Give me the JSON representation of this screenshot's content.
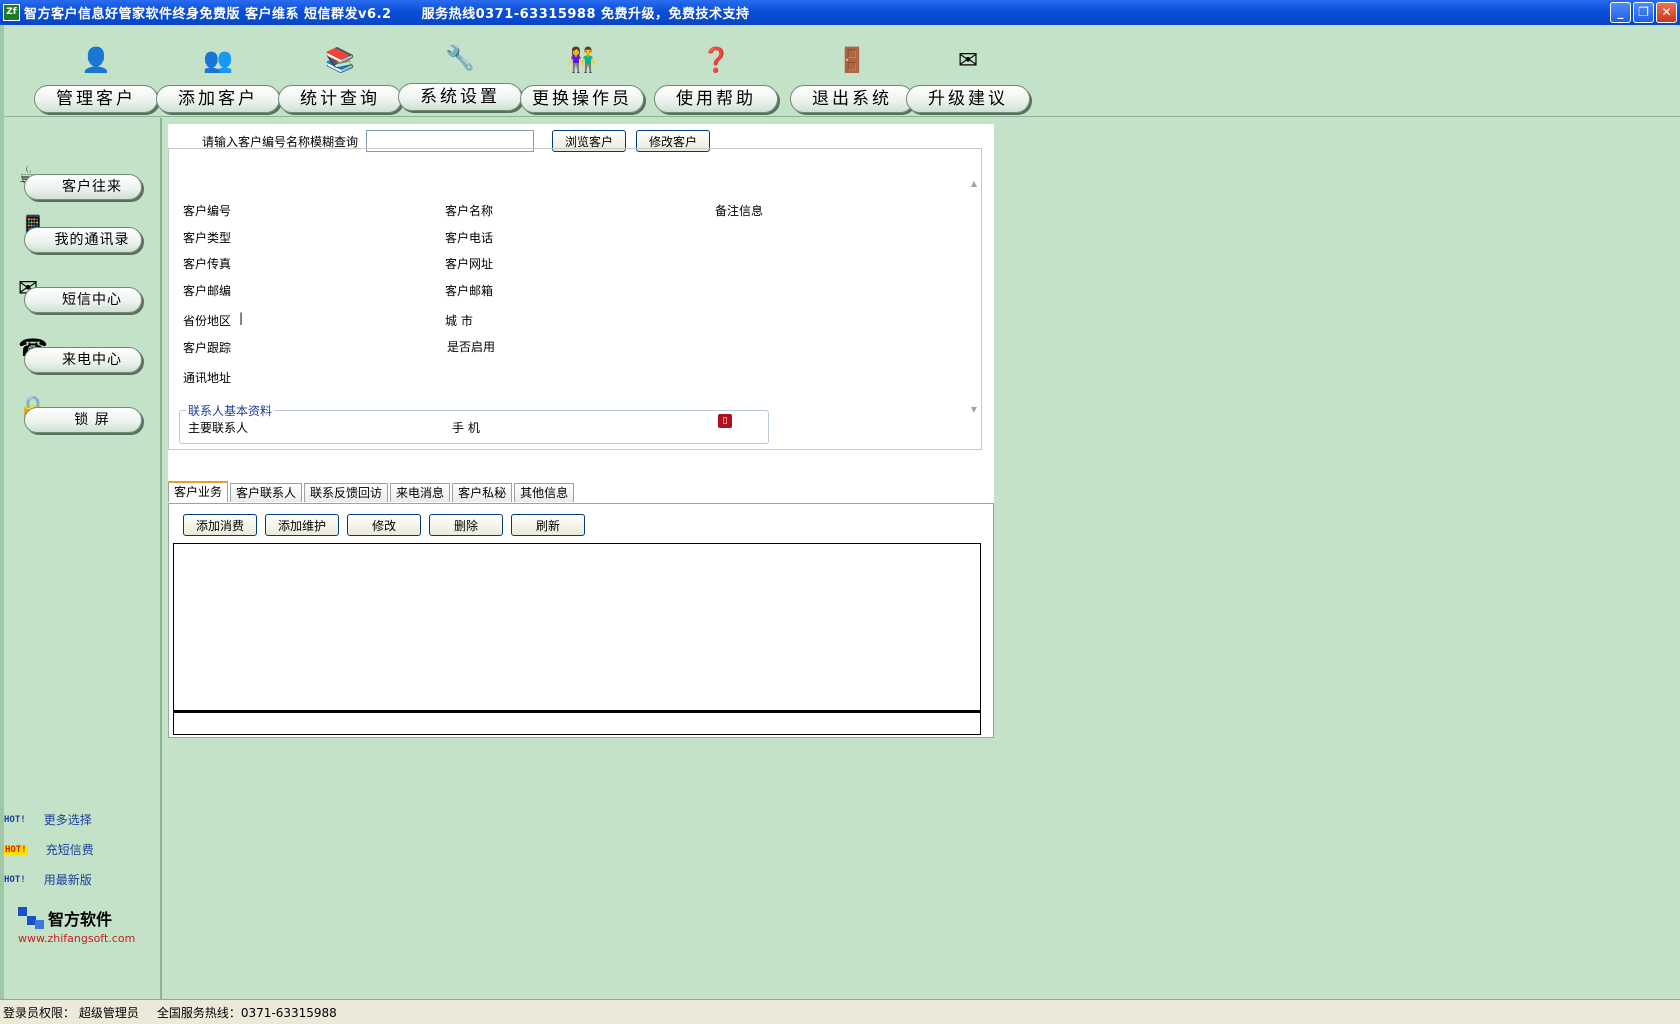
{
  "window": {
    "title": "智方客户信息好管家软件终身免费版  客户维系  短信群发v6.2",
    "hotline": "服务热线0371-63315988  免费升级，免费技术支持",
    "minimize": "_",
    "restore": "❐",
    "close": "✕"
  },
  "toolbar": [
    {
      "label": "管理客户",
      "icon": "user-icon"
    },
    {
      "label": "添加客户",
      "icon": "add-user-icon"
    },
    {
      "label": "统计查询",
      "icon": "book-search-icon"
    },
    {
      "label": "系统设置",
      "icon": "tools-icon"
    },
    {
      "label": "更换操作员",
      "icon": "users-icon"
    },
    {
      "label": "使用帮助",
      "icon": "help-icon"
    },
    {
      "label": "退出系统",
      "icon": "exit-icon"
    },
    {
      "label": "升级建议",
      "icon": "mail-icon"
    }
  ],
  "sidebar": [
    {
      "label": "客户往来",
      "icon": "exchange-icon"
    },
    {
      "label": "我的通讯录",
      "icon": "phone-book-icon"
    },
    {
      "label": "短信中心",
      "icon": "sms-icon"
    },
    {
      "label": "来电中心",
      "icon": "telephone-icon"
    },
    {
      "label": "锁    屏",
      "icon": "lock-icon"
    }
  ],
  "hot_links": [
    {
      "badge": "HOT!",
      "text": "更多选择"
    },
    {
      "badge": "HOT!",
      "text": "充短信费"
    },
    {
      "badge": "HOT!",
      "text": "用最新版"
    }
  ],
  "logo": {
    "name": "智方软件",
    "url": "www.zhifangsoft.com"
  },
  "search": {
    "label": "请输入客户编号名称模糊查询",
    "value": "",
    "browse_button": "浏览客户",
    "edit_button": "修改客户"
  },
  "fields": {
    "customer_id": "客户编号",
    "customer_name": "客户名称",
    "remarks": "备注信息",
    "customer_type": "客户类型",
    "customer_phone": "客户电话",
    "customer_fax": "客户传真",
    "customer_website": "客户网址",
    "customer_postcode": "客户邮编",
    "customer_email": "客户邮箱",
    "province": "省份地区",
    "province_value": "|",
    "city": "城    市",
    "follow_up": "客户跟踪",
    "enabled": "是否启用",
    "address": "通讯地址"
  },
  "contact": {
    "group_title": "联系人基本资料",
    "primary": "主要联系人",
    "mobile": "手    机"
  },
  "tabs": [
    "客户业务",
    "客户联系人",
    "联系反馈回访",
    "来电消息",
    "客户私秘",
    "其他信息"
  ],
  "actions": [
    "添加消费",
    "添加维护",
    "修改",
    "删除",
    "刷新"
  ],
  "status": {
    "login": "登录员权限： 超级管理员",
    "hotline": "全国服务热线：0371-63315988"
  },
  "colors": {
    "background": "#c4e2c8",
    "titlebar": "#0a4fd8",
    "link": "#1a3f9c",
    "logo_url": "#c81e1e"
  }
}
